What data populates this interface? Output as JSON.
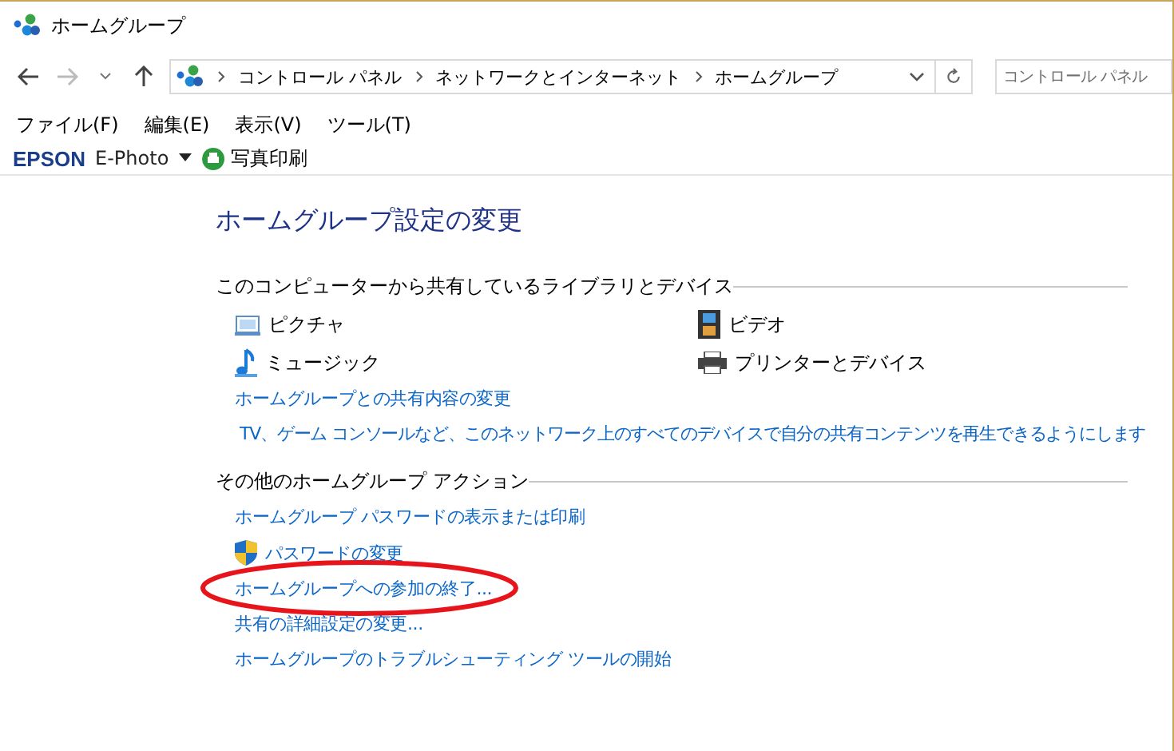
{
  "window": {
    "title": "ホームグループ"
  },
  "address_bar": {
    "breadcrumb": [
      "コントロール パネル",
      "ネットワークとインターネット",
      "ホームグループ"
    ],
    "search": {
      "placeholder": "コントロール パネル"
    }
  },
  "menu": [
    "ファイル(F)",
    "編集(E)",
    "表示(V)",
    "ツール(T)"
  ],
  "toolbar": {
    "brand": "EPSON",
    "app": "E-Photo",
    "action": "写真印刷"
  },
  "page_title": "ホームグループ設定の変更",
  "sections": [
    {
      "heading": "このコンピューターから共有しているライブラリとデバイス",
      "libraries": [
        {
          "label": "ピクチャ",
          "kind": "pictures"
        },
        {
          "label": "ビデオ",
          "kind": "videos"
        },
        {
          "label": "ミュージック",
          "kind": "music"
        },
        {
          "label": "プリンターとデバイス",
          "kind": "printers"
        }
      ],
      "links": [
        {
          "label": "ホームグループとの共有内容の変更",
          "kind": "link",
          "circled": false
        },
        {
          "label": "TV、ゲーム コンソールなど、このネットワーク上のすべてのデバイスで自分の共有コンテンツを再生できるようにします",
          "kind": "indented"
        }
      ]
    },
    {
      "heading": "その他のホームグループ アクション",
      "links": [
        {
          "label": "ホームグループ パスワードの表示または印刷",
          "kind": "link",
          "circled": false
        },
        {
          "label": "パスワードの変更",
          "kind": "shield"
        },
        {
          "label": "ホームグループへの参加の終了...",
          "kind": "link",
          "circled": true
        },
        {
          "label": "共有の詳細設定の変更...",
          "kind": "link",
          "circled": false
        },
        {
          "label": "ホームグループのトラブルシューティング ツールの開始",
          "kind": "link",
          "circled": false
        }
      ]
    }
  ]
}
